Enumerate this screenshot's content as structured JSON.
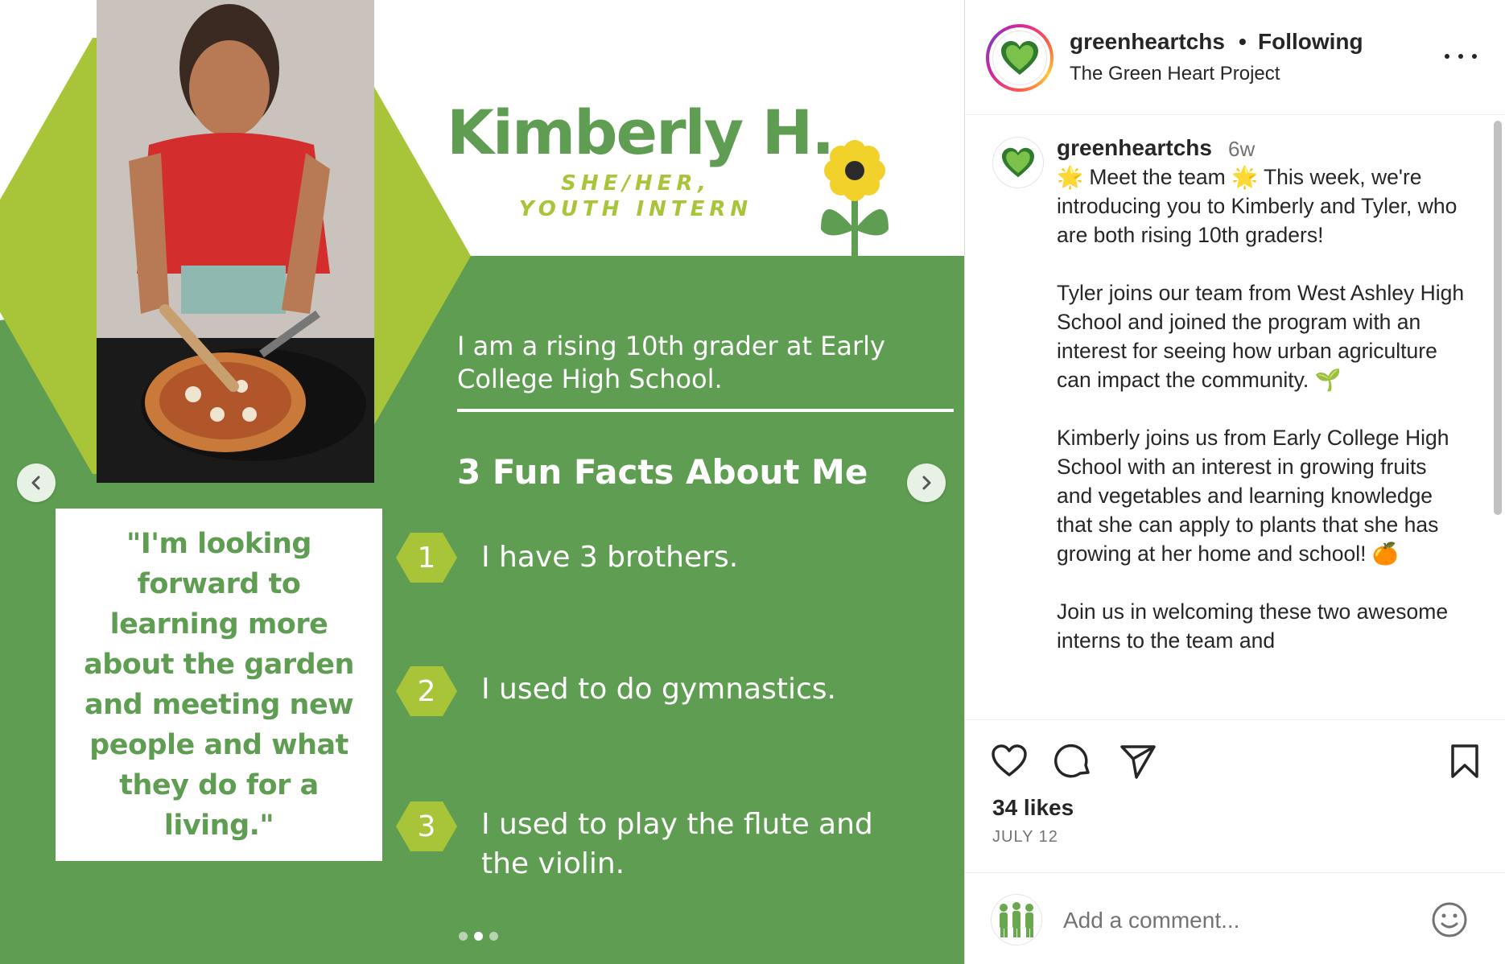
{
  "post_image": {
    "name": "Kimberly H.",
    "role_line1": "SHE/HER,",
    "role_line2": "YOUTH INTERN",
    "intro": "I am a rising 10th grader at Early College High School.",
    "facts_heading": "3 Fun Facts About Me",
    "facts": [
      {
        "number": "1",
        "text": "I have 3 brothers."
      },
      {
        "number": "2",
        "text": "I used to do gymnastics."
      },
      {
        "number": "3",
        "text": "I used to play the flute and the violin."
      }
    ],
    "quote": "\"I'm looking forward to learning more about the garden and meeting new people and what they do for a living.\"",
    "carousel_dots": 3,
    "active_dot": 1,
    "colors": {
      "green": "#5f9e52",
      "lime": "#a8c53a",
      "white": "#ffffff"
    }
  },
  "header": {
    "username": "greenheartchs",
    "separator": "•",
    "follow_status": "Following",
    "subtitle": "The Green Heart Project"
  },
  "caption": {
    "username": "greenheartchs",
    "time": "6w",
    "paragraphs": [
      "🌟 Meet the team 🌟 This week, we're introducing you to Kimberly and Tyler, who are both rising 10th graders!",
      "Tyler joins our team from West Ashley High School and joined the program with an interest for seeing how urban agriculture can impact the community. 🌱",
      "Kimberly joins us from Early College High School with an interest in growing fruits and vegetables and learning knowledge that she can apply to plants that she has growing at her home and school! 🍊",
      "Join us in welcoming these two awesome interns to the team and"
    ]
  },
  "stats": {
    "likes": "34 likes",
    "date": "JULY 12"
  },
  "comment": {
    "placeholder": "Add a comment..."
  },
  "icons": [
    "heart-icon",
    "comment-icon",
    "share-icon",
    "bookmark-icon",
    "more-icon",
    "emoji-icon",
    "chevron-left-icon",
    "chevron-right-icon"
  ]
}
